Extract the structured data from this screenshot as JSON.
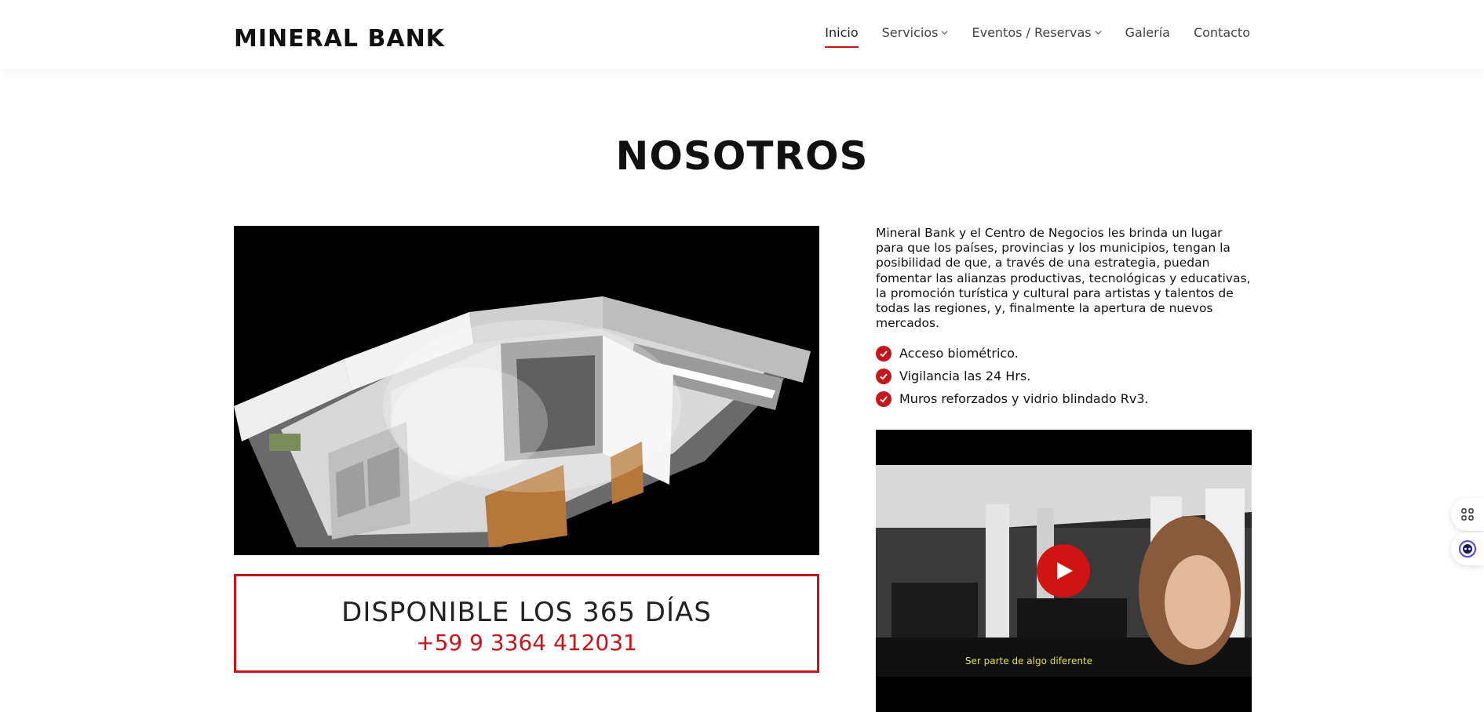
{
  "brand": "MINERAL BANK",
  "nav": [
    {
      "label": "Inicio",
      "active": true,
      "dropdown": false
    },
    {
      "label": "Servicios",
      "active": false,
      "dropdown": true
    },
    {
      "label": "Eventos / Reservas",
      "active": false,
      "dropdown": true
    },
    {
      "label": "Galería",
      "active": false,
      "dropdown": false
    },
    {
      "label": "Contacto",
      "active": false,
      "dropdown": false
    }
  ],
  "section": {
    "title": "NOSOTROS",
    "description": "Mineral Bank y el Centro de Negocios les brinda un lugar para que los países, provincias y los municipios, tengan la posibilidad de que, a través de una estrategia, puedan fomentar las alianzas productivas, tecnológicas y educativas, la promoción turística y cultural para artistas y talentos de todas las regiones, y, finalmente la apertura de nuevos mercados.",
    "features": [
      "Acceso biométrico.",
      "Vigilancia las 24 Hrs.",
      "Muros reforzados y vidrio blindado Rv3."
    ]
  },
  "cta": {
    "title": "DISPONIBLE LOS 365 DÍAS",
    "phone": "+59 9 3364 412031"
  },
  "video": {
    "subtitle": "Ser parte de algo diferente"
  },
  "colors": {
    "accent": "#c4161c",
    "play": "#d01414"
  },
  "icons": {
    "check": "check-circle-icon",
    "play": "play-icon",
    "widget_top": "apps-grid-icon",
    "widget_bottom": "assistant-icon"
  }
}
